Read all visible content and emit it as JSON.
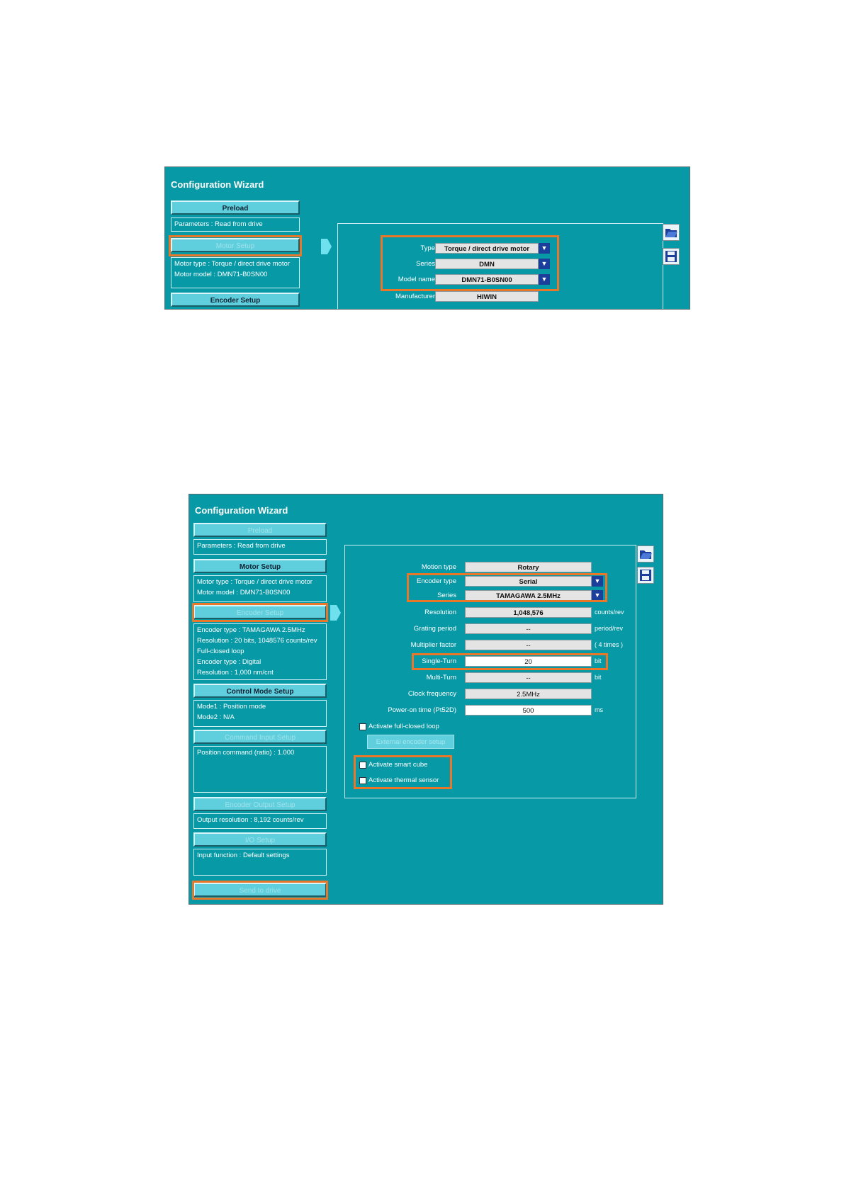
{
  "window1": {
    "title": "Configuration Wizard",
    "nav": {
      "preload": "Preload",
      "parameters_info": "Parameters : Read from drive",
      "motor_setup": "Motor Setup",
      "motor_type_info": "Motor type : Torque / direct drive motor",
      "motor_model_info": "Motor model   : DMN71-B0SN00",
      "encoder_setup": "Encoder Setup"
    },
    "form": {
      "type_label": "Type",
      "type_value": "Torque / direct drive motor",
      "series_label": "Series",
      "series_value": "DMN",
      "model_label": "Model name",
      "model_value": "DMN71-B0SN00",
      "manufacturer_label": "Manufacturer",
      "manufacturer_value": "HIWIN"
    }
  },
  "window2": {
    "title": "Configuration Wizard",
    "nav": {
      "preload": "Preload",
      "parameters_info": "Parameters : Read from drive",
      "motor_setup": "Motor Setup",
      "motor_info": [
        "Motor type : Torque / direct drive motor",
        "Motor model   : DMN71-B0SN00"
      ],
      "encoder_setup": "Encoder Setup",
      "encoder_info": [
        "Encoder type : TAMAGAWA 2.5MHz",
        "Resolution : 20 bits, 1048576 counts/rev",
        "Full-closed loop",
        "Encoder type : Digital",
        "Resolution : 1,000 nm/cnt"
      ],
      "control_mode_setup": "Control Mode Setup",
      "control_info": [
        "Mode1 : Position mode",
        "Mode2 : N/A"
      ],
      "command_input_setup": "Command Input Setup",
      "command_info": "Position command (ratio) :     1.000",
      "encoder_output_setup": "Encoder Output Setup",
      "encoder_output_info": "Output resolution : 8,192 counts/rev",
      "io_setup": "I/O Setup",
      "io_info": "Input function : Default settings",
      "send_to_drive": "Send to drive"
    },
    "form": {
      "motion_type_label": "Motion type",
      "motion_type_value": "Rotary",
      "encoder_type_label": "Encoder type",
      "encoder_type_value": "Serial",
      "series_label": "Series",
      "series_value": "TAMAGAWA 2.5MHz",
      "resolution_label": "Resolution",
      "resolution_value": "1,048,576",
      "resolution_unit": "counts/rev",
      "grating_label": "Grating period",
      "grating_value": "--",
      "grating_unit": "period/rev",
      "multiplier_label": "Multiplier factor",
      "multiplier_value": "--",
      "multiplier_unit": "( 4 times )",
      "single_turn_label": "Single-Turn",
      "single_turn_value": "20",
      "single_turn_unit": "bit",
      "multi_turn_label": "Multi-Turn",
      "multi_turn_value": "--",
      "multi_turn_unit": "bit",
      "clock_label": "Clock frequency",
      "clock_value": "2.5MHz",
      "power_on_label": "Power-on time (Pt52D)",
      "power_on_value": "500",
      "power_on_unit": "ms",
      "full_closed_label": "Activate full-closed loop",
      "external_encoder_button": "External encoder setup",
      "smart_cube_label": "Activate smart cube",
      "thermal_sensor_label": "Activate thermal sensor"
    }
  },
  "icons": {
    "open": "open-folder-icon",
    "save": "floppy-disk-icon",
    "dropdown": "triangle-down"
  },
  "colors": {
    "window_bg": "#0899a6",
    "button_bg": "#5fcfdd",
    "highlight": "#e8772a",
    "dropdown": "#1b3f9a"
  }
}
